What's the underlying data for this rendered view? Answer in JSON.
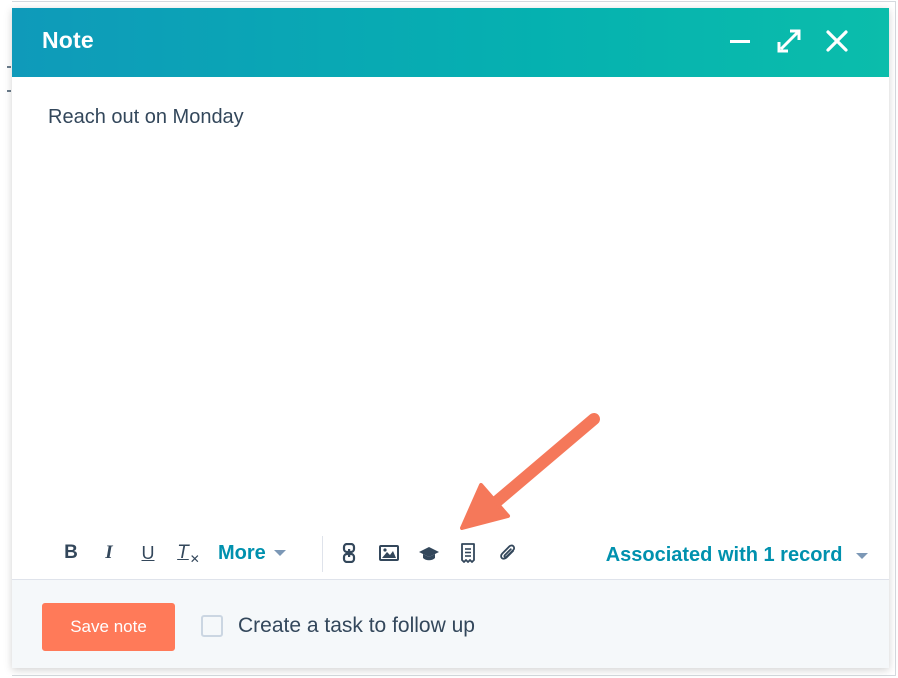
{
  "dialog": {
    "title": "Note",
    "header_actions": [
      {
        "icon": "minimize-icon"
      },
      {
        "icon": "expand-icon"
      },
      {
        "icon": "close-icon"
      }
    ]
  },
  "editor": {
    "content": "Reach out on Monday"
  },
  "toolbar": {
    "bold_label": "B",
    "italic_label": "I",
    "underline_label": "U",
    "clear_format_label": "T",
    "more_label": "More",
    "icons": [
      "link-icon",
      "image-icon",
      "graduation-cap-icon",
      "document-icon",
      "paperclip-icon"
    ],
    "associated_label": "Associated with 1 record"
  },
  "footer": {
    "save_label": "Save note",
    "task_checkbox_label": "Create a task to follow up",
    "task_checkbox_checked": false
  },
  "colors": {
    "header_start": "#0f9aba",
    "header_end": "#0bbdab",
    "primary_button": "#ff7a59",
    "link": "#0091ae",
    "text": "#33475b",
    "annotation_arrow": "#f5785a"
  }
}
